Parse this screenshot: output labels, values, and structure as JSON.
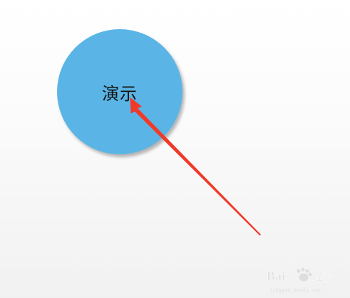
{
  "slide": {
    "circle": {
      "label": "演示",
      "fill_color": "#5ab5e6"
    },
    "arrow": {
      "color": "#f03a2a"
    },
    "watermark": {
      "brand_text": "Baidu",
      "suffix_text": "经验"
    }
  }
}
